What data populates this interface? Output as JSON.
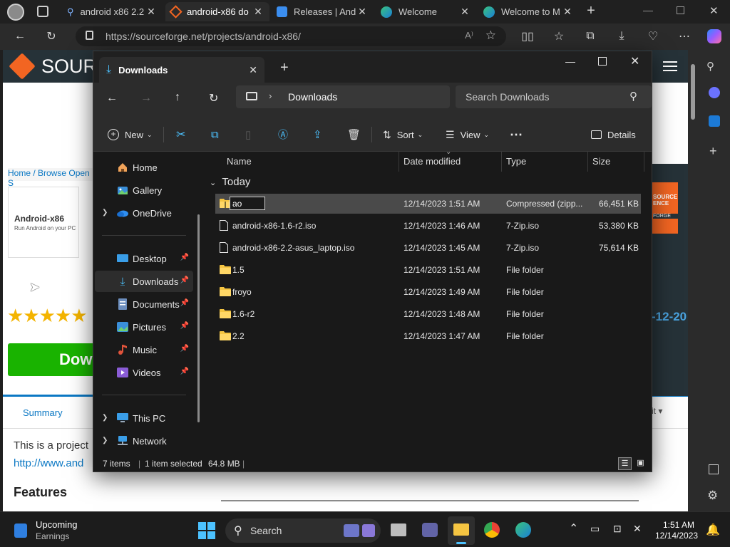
{
  "browser": {
    "tabs": [
      {
        "title": "android x86 2.2",
        "icon": "search-icon"
      },
      {
        "title": "android-x86 do",
        "icon": "sourceforge-icon"
      },
      {
        "title": "Releases | Andr",
        "icon": "shield-icon"
      },
      {
        "title": "Welcome",
        "icon": "edge-icon"
      },
      {
        "title": "Welcome to M",
        "icon": "edge-icon"
      }
    ],
    "url": "https://sourceforge.net/projects/android-x86/"
  },
  "webpage": {
    "logo_text": "SOURC",
    "breadcrumb": "Home / Browse Open S",
    "project_card_title": "Android-x86",
    "project_card_sub": "Run Android on your PC",
    "download_label": "Dow",
    "summary_tab": "Summary",
    "desc_text": "This is a project",
    "link_text": "http://www.and",
    "features_heading": "Features",
    "date_fragment": "-12-20",
    "badge_top": "SOURCE",
    "badge_mid": "ENCE",
    "badge_bot": "FORGE",
    "right_fragment": "it ▾",
    "rating_stars": 5
  },
  "explorer": {
    "tab_title": "Downloads",
    "breadcrumb": "Downloads",
    "search_placeholder": "Search Downloads",
    "toolbar": {
      "new_label": "New",
      "sort_label": "Sort",
      "view_label": "View",
      "details_label": "Details"
    },
    "nav": {
      "home": "Home",
      "gallery": "Gallery",
      "onedrive": "OneDrive",
      "desktop": "Desktop",
      "downloads": "Downloads",
      "documents": "Documents",
      "pictures": "Pictures",
      "music": "Music",
      "videos": "Videos",
      "thispc": "This PC",
      "network": "Network"
    },
    "columns": {
      "name": "Name",
      "date": "Date modified",
      "type": "Type",
      "size": "Size"
    },
    "group_label": "Today",
    "files": [
      {
        "name": "ao",
        "date": "12/14/2023 1:51 AM",
        "type": "Compressed (zipp...",
        "size": "66,451 KB",
        "kind": "zip",
        "selected": true,
        "renaming": true
      },
      {
        "name": "android-x86-1.6-r2.iso",
        "date": "12/14/2023 1:46 AM",
        "type": "7-Zip.iso",
        "size": "53,380 KB",
        "kind": "file"
      },
      {
        "name": "android-x86-2.2-asus_laptop.iso",
        "date": "12/14/2023 1:45 AM",
        "type": "7-Zip.iso",
        "size": "75,614 KB",
        "kind": "file"
      },
      {
        "name": "1.5",
        "date": "12/14/2023 1:51 AM",
        "type": "File folder",
        "size": "",
        "kind": "folder"
      },
      {
        "name": "froyo",
        "date": "12/14/2023 1:49 AM",
        "type": "File folder",
        "size": "",
        "kind": "folder"
      },
      {
        "name": "1.6-r2",
        "date": "12/14/2023 1:48 AM",
        "type": "File folder",
        "size": "",
        "kind": "folder"
      },
      {
        "name": "2.2",
        "date": "12/14/2023 1:47 AM",
        "type": "File folder",
        "size": "",
        "kind": "folder"
      }
    ],
    "status": {
      "items": "7 items",
      "selected": "1 item selected",
      "size": "64.8 MB"
    }
  },
  "taskbar": {
    "widget_title": "Upcoming",
    "widget_sub": "Earnings",
    "search_label": "Search",
    "time": "1:51 AM",
    "date": "12/14/2023"
  },
  "colors": {
    "accent": "#4cc2ff",
    "folder": "#f5c542",
    "sourceforge_orange": "#f26522",
    "download_green": "#19b300"
  }
}
